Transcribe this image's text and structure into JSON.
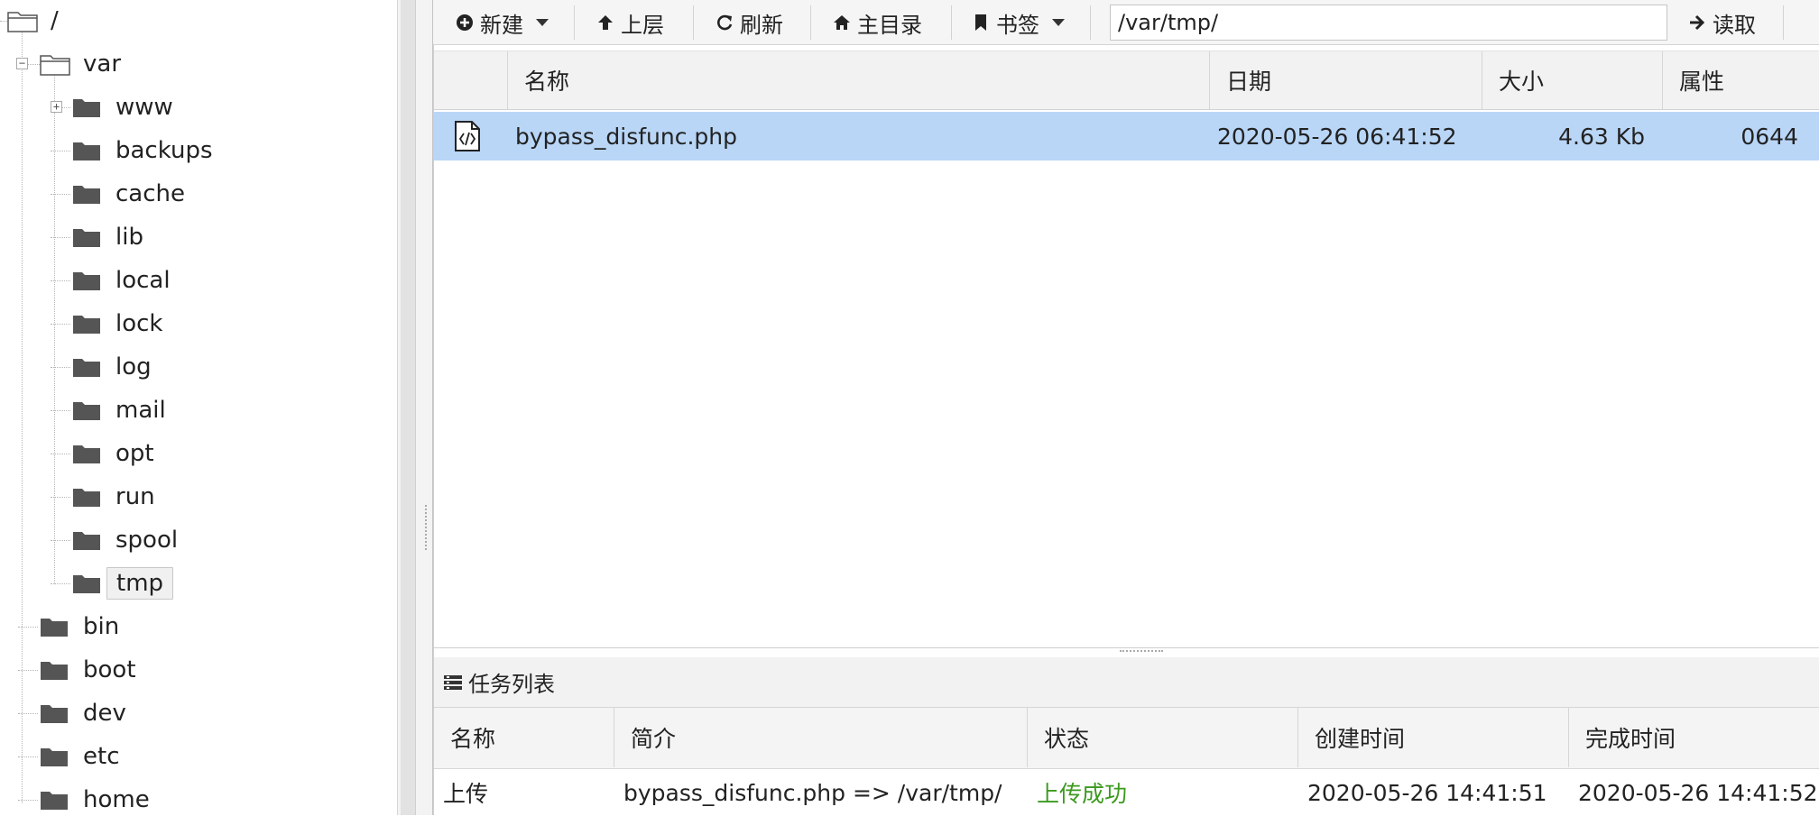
{
  "tree": {
    "root": "/",
    "var": "var",
    "var_children": [
      "www",
      "backups",
      "cache",
      "lib",
      "local",
      "lock",
      "log",
      "mail",
      "opt",
      "run",
      "spool",
      "tmp"
    ],
    "root_children": [
      "bin",
      "boot",
      "dev",
      "etc",
      "home"
    ],
    "selected": "tmp"
  },
  "toolbar": {
    "new_label": "新建",
    "up_label": "上层",
    "refresh_label": "刷新",
    "home_label": "主目录",
    "bookmark_label": "书签",
    "path_value": "/var/tmp/",
    "read_label": "读取"
  },
  "filelist": {
    "columns": [
      "名称",
      "日期",
      "大小",
      "属性"
    ],
    "rows": [
      {
        "name": "bypass_disfunc.php",
        "date": "2020-05-26 06:41:52",
        "size": "4.63 Kb",
        "perm": "0644",
        "icon": "php-file-icon"
      }
    ]
  },
  "tasks": {
    "title": "任务列表",
    "columns": [
      "名称",
      "简介",
      "状态",
      "创建时间",
      "完成时间"
    ],
    "rows": [
      {
        "name": "上传",
        "desc": "bypass_disfunc.php => /var/tmp/",
        "status": "上传成功",
        "created": "2020-05-26 14:41:51",
        "finished": "2020-05-26 14:41:52"
      }
    ]
  },
  "colors": {
    "selected_row": "#b9d6f7",
    "success": "#3c9a1f",
    "folder": "#555555"
  }
}
